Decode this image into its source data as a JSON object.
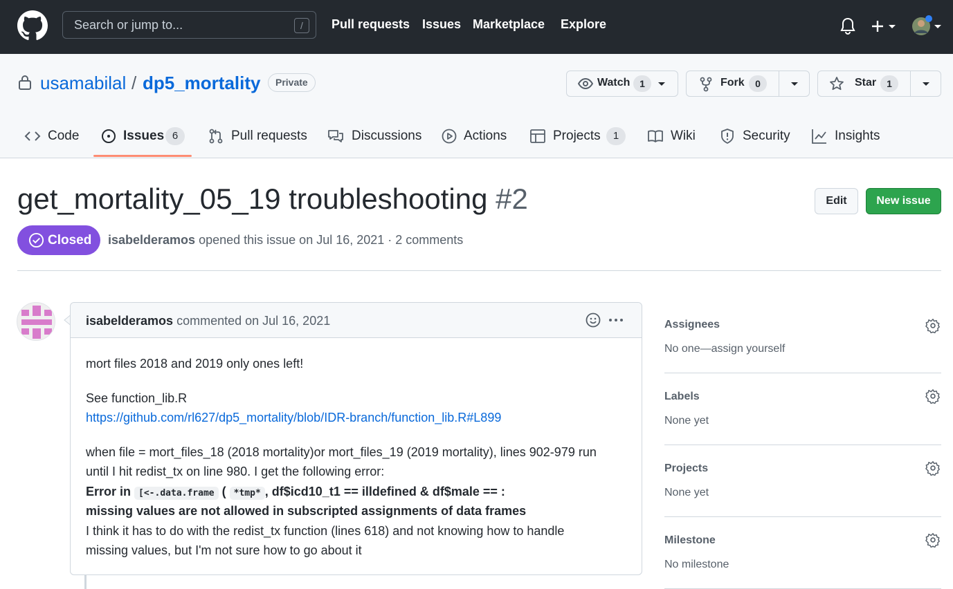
{
  "header": {
    "search_placeholder": "Search or jump to...",
    "search_shortcut": "/",
    "nav": [
      "Pull requests",
      "Issues",
      "Marketplace",
      "Explore"
    ]
  },
  "repo": {
    "owner": "usamabilal",
    "separator": "/",
    "name": "dp5_mortality",
    "visibility": "Private",
    "watch": {
      "label": "Watch",
      "count": "1"
    },
    "fork": {
      "label": "Fork",
      "count": "0"
    },
    "star": {
      "label": "Star",
      "count": "1"
    }
  },
  "tabs": [
    {
      "label": "Code"
    },
    {
      "label": "Issues",
      "count": "6"
    },
    {
      "label": "Pull requests"
    },
    {
      "label": "Discussions"
    },
    {
      "label": "Actions"
    },
    {
      "label": "Projects",
      "count": "1"
    },
    {
      "label": "Wiki"
    },
    {
      "label": "Security"
    },
    {
      "label": "Insights"
    }
  ],
  "issue": {
    "title": "get_mortality_05_19 troubleshooting",
    "number": "#2",
    "state": "Closed",
    "author": "isabelderamos",
    "meta_text": "opened this issue on Jul 16, 2021 · 2 comments",
    "edit_label": "Edit",
    "new_issue_label": "New issue"
  },
  "comment": {
    "author": "isabelderamos",
    "meta": "commented on Jul 16, 2021",
    "line1": "mort files 2018 and 2019 only ones left!",
    "line2": "See function_lib.R",
    "link": "https://github.com/rl627/dp5_mortality/blob/IDR-branch/function_lib.R#L899",
    "line3": "when file = mort_files_18 (2018 mortality)or mort_files_19 (2019 mortality), lines 902-979 run",
    "line4": "until I hit redist_tx on line 980. I get the following error:",
    "err_a": "Error in",
    "err_code1": "[<-.data.frame",
    "err_b": "(",
    "err_code2": "*tmp*",
    "err_c": ", df$icd10_t1 == illdefined & df$male == :",
    "line6": "missing values are not allowed in subscripted assignments of data frames",
    "line7": "I think it has to do with the redist_tx function (lines 618) and not knowing how to handle",
    "line8": "missing values, but I'm not sure how to go about it"
  },
  "sidebar": [
    {
      "title": "Assignees",
      "value": "No one—assign yourself"
    },
    {
      "title": "Labels",
      "value": "None yet"
    },
    {
      "title": "Projects",
      "value": "None yet"
    },
    {
      "title": "Milestone",
      "value": "No milestone"
    }
  ],
  "colors": {
    "header_bg": "#24292f",
    "link": "#0969da",
    "closed_badge": "#8250df",
    "new_issue": "#2da44e",
    "tab_underline": "#fd8c73"
  }
}
